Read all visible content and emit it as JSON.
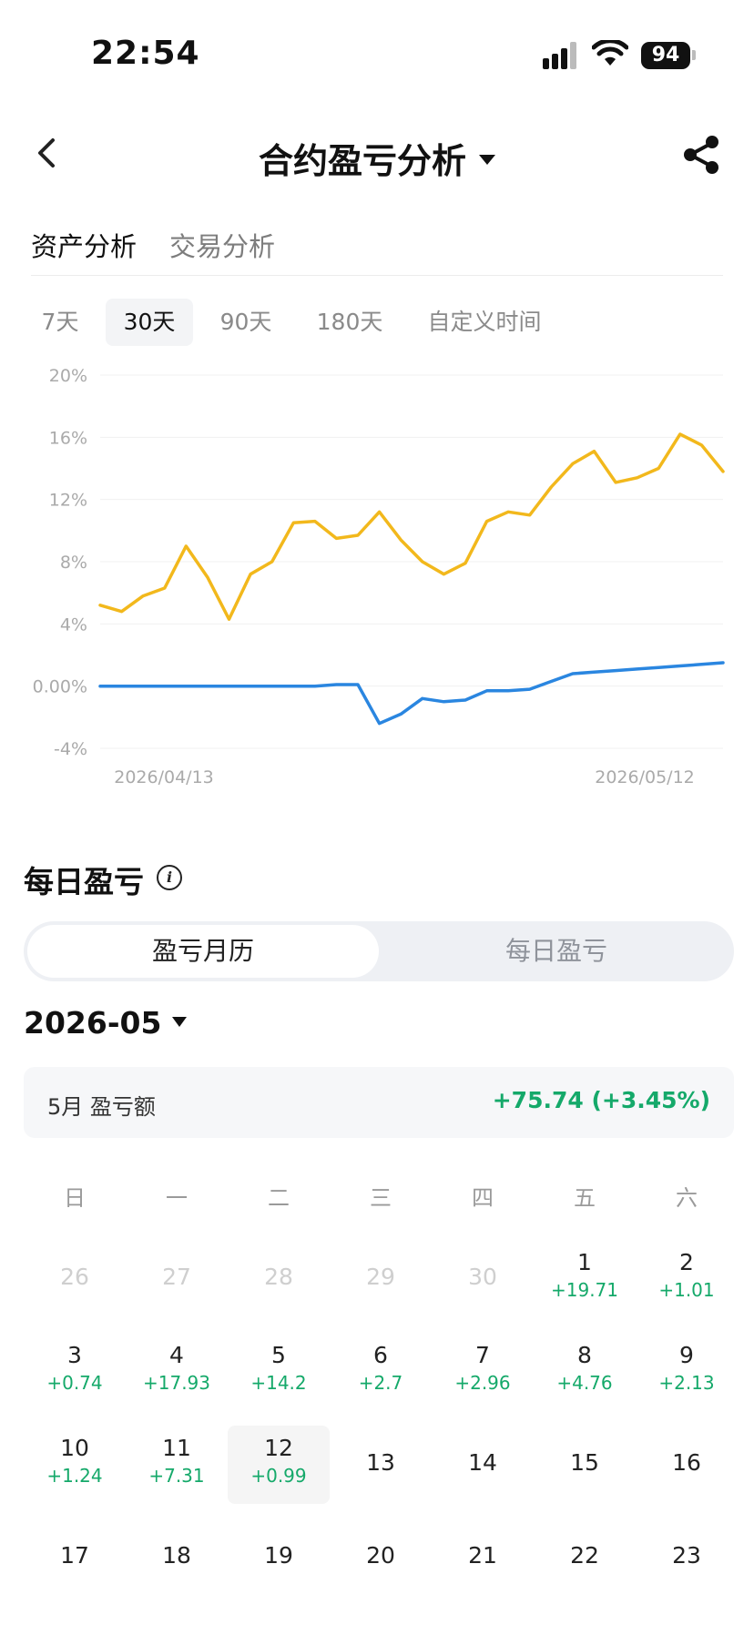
{
  "status_bar": {
    "time": "22:54",
    "battery": "94"
  },
  "nav": {
    "title": "合约盈亏分析"
  },
  "tabs": [
    "资产分析",
    "交易分析"
  ],
  "ranges": [
    "7天",
    "30天",
    "90天",
    "180天",
    "自定义时间"
  ],
  "chart_data": {
    "type": "line",
    "x_labels": [
      "2026/04/13",
      "2026/05/12"
    ],
    "y_ticks": [
      "20%",
      "16%",
      "12%",
      "8%",
      "4%",
      "0.00%",
      "-4%"
    ],
    "ylim": [
      -4,
      20
    ],
    "series": [
      {
        "color": "#f2b81c",
        "values": [
          5.2,
          4.8,
          5.8,
          6.3,
          9.0,
          7.0,
          4.3,
          7.2,
          8.0,
          10.5,
          10.6,
          9.5,
          9.7,
          11.2,
          9.4,
          8.0,
          7.2,
          7.9,
          10.6,
          11.2,
          11.0,
          12.8,
          14.3,
          15.1,
          13.1,
          13.4,
          14.0,
          16.2,
          15.5,
          13.8
        ]
      },
      {
        "color": "#2a86e0",
        "values": [
          0,
          0,
          0,
          0,
          0,
          0,
          0,
          0,
          0,
          0,
          0,
          0.1,
          0.1,
          -2.4,
          -1.8,
          -0.8,
          -1.0,
          -0.9,
          -0.3,
          -0.3,
          -0.2,
          0.3,
          0.8,
          0.9,
          1.0,
          1.1,
          1.2,
          1.3,
          1.4,
          1.5
        ]
      }
    ],
    "grid": true
  },
  "daily": {
    "title": "每日盈亏",
    "segments": [
      "盈亏月历",
      "每日盈亏"
    ],
    "month": "2026-05",
    "summary_label": "5月 盈亏额",
    "summary_value": "+75.74 (+3.45%)",
    "weekdays": [
      "日",
      "一",
      "二",
      "三",
      "四",
      "五",
      "六"
    ],
    "days": [
      {
        "n": "26",
        "muted": true
      },
      {
        "n": "27",
        "muted": true
      },
      {
        "n": "28",
        "muted": true
      },
      {
        "n": "29",
        "muted": true
      },
      {
        "n": "30",
        "muted": true
      },
      {
        "n": "1",
        "pnl": "+19.71"
      },
      {
        "n": "2",
        "pnl": "+1.01"
      },
      {
        "n": "3",
        "pnl": "+0.74"
      },
      {
        "n": "4",
        "pnl": "+17.93"
      },
      {
        "n": "5",
        "pnl": "+14.2"
      },
      {
        "n": "6",
        "pnl": "+2.7"
      },
      {
        "n": "7",
        "pnl": "+2.96"
      },
      {
        "n": "8",
        "pnl": "+4.76"
      },
      {
        "n": "9",
        "pnl": "+2.13"
      },
      {
        "n": "10",
        "pnl": "+1.24"
      },
      {
        "n": "11",
        "pnl": "+7.31"
      },
      {
        "n": "12",
        "pnl": "+0.99",
        "today": true
      },
      {
        "n": "13"
      },
      {
        "n": "14"
      },
      {
        "n": "15"
      },
      {
        "n": "16"
      },
      {
        "n": "17"
      },
      {
        "n": "18"
      },
      {
        "n": "19"
      },
      {
        "n": "20"
      },
      {
        "n": "21"
      },
      {
        "n": "22"
      },
      {
        "n": "23"
      }
    ]
  }
}
